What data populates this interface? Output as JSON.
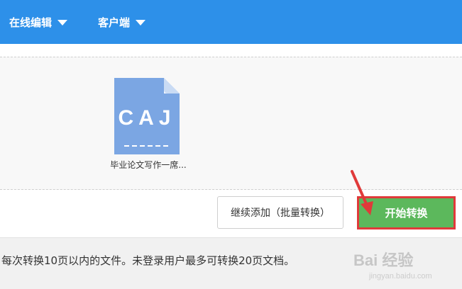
{
  "nav": {
    "items": [
      {
        "label": "在线编辑",
        "icon": "caret-down-icon"
      },
      {
        "label": "客户端",
        "icon": "caret-down-icon"
      }
    ]
  },
  "upload": {
    "file": {
      "type_label": "CAJ",
      "name": "毕业论文写作一席...",
      "icon": "caj-file-icon"
    },
    "buttons": {
      "continue_label": "继续添加（批量转换）",
      "start_label": "开始转换"
    }
  },
  "tip_text": "每次转换10页以内的文件。未登录用户最多可转换20页文档。",
  "watermark": {
    "logo": "Bai 经验",
    "url": "jingyan.baidu.com"
  },
  "colors": {
    "nav_bg": "#2d90e9",
    "start_button": "#5cb85c",
    "highlight_border": "#e03a3a",
    "file_icon": "#7ba6e3"
  }
}
